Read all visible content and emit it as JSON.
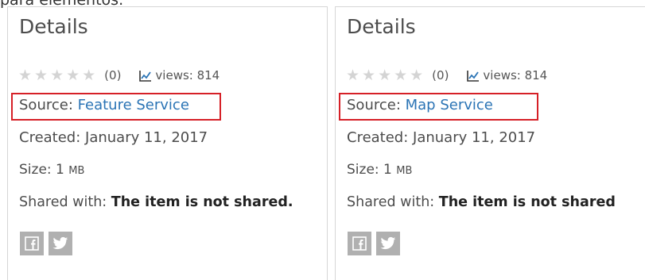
{
  "top_text": "para elementos.",
  "panels": [
    {
      "title": "Details",
      "rating_stars": "★★★★★",
      "rating_count": "(0)",
      "views": "views: 814",
      "source_label": "Source:",
      "source_value": "Feature Service",
      "created": "Created: January 11, 2017",
      "size_label": "Size: 1",
      "size_unit": "MB",
      "shared_label": "Shared with:",
      "shared_value": "The item is not shared.",
      "icons": [
        "facebook-icon",
        "twitter-icon"
      ]
    },
    {
      "title": "Details",
      "rating_stars": "★★★★★",
      "rating_count": "(0)",
      "views": "views: 814",
      "source_label": "Source:",
      "source_value": "Map Service",
      "created": "Created: January 11, 2017",
      "size_label": "Size: 1",
      "size_unit": "MB",
      "shared_label": "Shared with:",
      "shared_value": "The item is not shared",
      "icons": [
        "facebook-icon",
        "twitter-icon"
      ]
    }
  ],
  "colors": {
    "link": "#2b74b5",
    "highlight_border": "#d62027",
    "star": "#d4d4d4",
    "social_bg": "#b0b0b0"
  }
}
